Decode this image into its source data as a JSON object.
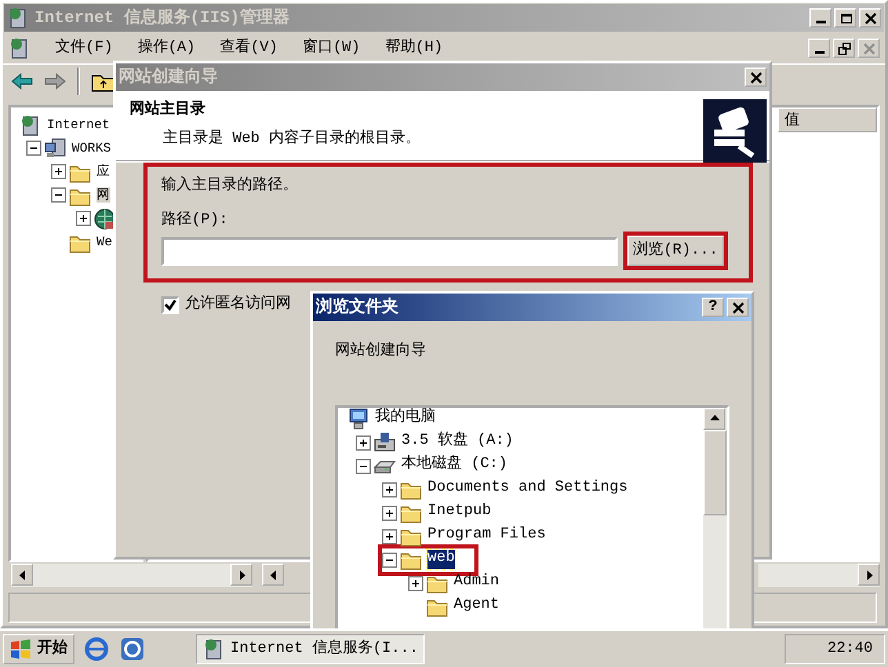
{
  "main_window": {
    "title": "Internet 信息服务(IIS)管理器",
    "menu": [
      {
        "label": "文件(F)"
      },
      {
        "label": "操作(A)"
      },
      {
        "label": "查看(V)"
      },
      {
        "label": "窗口(W)"
      },
      {
        "label": "帮助(H)"
      }
    ],
    "tree": [
      {
        "label": "Internet",
        "kind": "iis",
        "selected": false,
        "children": [
          {
            "label": "WORKS",
            "kind": "server",
            "expanded": true,
            "selected": false,
            "children": [
              {
                "label": "应",
                "kind": "folder",
                "expanded": false,
                "selected": false
              },
              {
                "label": "网",
                "kind": "folder",
                "expanded": true,
                "selected": true,
                "children": [
                  {
                    "kind": "globe",
                    "expanded": false,
                    "selected": false
                  }
                ]
              },
              {
                "label": "We",
                "kind": "folder",
                "selected": false
              }
            ]
          }
        ]
      }
    ],
    "right_header": "值"
  },
  "wizard": {
    "title": "网站创建向导",
    "heading": "网站主目录",
    "subheading": "主目录是 Web 内容子目录的根目录。",
    "path_group": {
      "annotated": true,
      "prompt": "输入主目录的路径。",
      "label": "路径(P):"
    },
    "browse_button": {
      "label": "浏览(R)...",
      "annotated": true
    },
    "anonymous_checkbox": {
      "label": "允许匿名访问网",
      "checked": true
    }
  },
  "browse_dialog": {
    "title": "浏览文件夹",
    "help_button": "?",
    "description": "网站创建向导",
    "tree": [
      {
        "label": "我的电脑",
        "kind": "computer",
        "selected": false,
        "children": [
          {
            "label": "3.5 软盘 (A:)",
            "kind": "floppy",
            "expanded": false,
            "selected": false
          },
          {
            "label": "本地磁盘 (C:)",
            "kind": "drive",
            "expanded": true,
            "selected": false,
            "children": [
              {
                "label": "Documents and Settings",
                "kind": "folder",
                "expanded": false,
                "selected": false
              },
              {
                "label": "Inetpub",
                "kind": "folder",
                "expanded": false,
                "selected": false
              },
              {
                "label": "Program Files",
                "kind": "folder",
                "expanded": false,
                "selected": false
              },
              {
                "label": "web",
                "kind": "folder",
                "expanded": true,
                "selected": true,
                "annotated": true,
                "children": [
                  {
                    "label": "Admin",
                    "kind": "folder",
                    "expanded": false,
                    "selected": false
                  },
                  {
                    "label": "Agent",
                    "kind": "folder",
                    "selected": false
                  }
                ]
              }
            ]
          }
        ]
      }
    ]
  },
  "taskbar": {
    "start": "开始",
    "tasks": [
      {
        "label": "Internet 信息服务(I..."
      }
    ],
    "clock": "22:40"
  }
}
